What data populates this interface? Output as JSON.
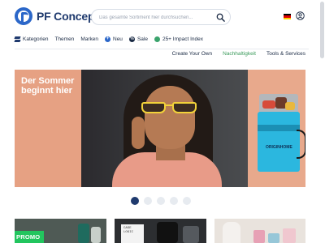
{
  "brand": {
    "name": "PF Concept"
  },
  "search": {
    "placeholder": "Das gesamte Sortiment hier durchsuchen..."
  },
  "header": {
    "language": "de",
    "flag_colors": [
      "#000000",
      "#dd0000",
      "#ffce00"
    ]
  },
  "category_nav": {
    "items": [
      {
        "label": "Kategorien",
        "icon": "layers-icon"
      },
      {
        "label": "Themen"
      },
      {
        "label": "Marken"
      },
      {
        "label": "Neu",
        "icon": "new-icon"
      },
      {
        "label": "Sale",
        "icon": "sale-icon"
      },
      {
        "label": "25+ Impact Index",
        "icon": "impact-icon"
      }
    ]
  },
  "secondary_nav": {
    "items": [
      {
        "label": "Create Your Own"
      },
      {
        "label": "Nachhaltigkeit"
      },
      {
        "label": "Tools & Services"
      }
    ]
  },
  "hero": {
    "title": "Der Sommer\nbeginnt hier",
    "product_brand": "ORIGINHOME",
    "active_slide": 1,
    "slide_count": 5
  },
  "cards": [
    {
      "label": "PROMO"
    },
    {
      "label": "CASE\nLOGIC"
    },
    {
      "label": ""
    }
  ],
  "colors": {
    "primary": "#1f3a6e",
    "accent_blue": "#2b67c9",
    "accent_green": "#3a9a5a",
    "promo_green": "#22c55e"
  }
}
